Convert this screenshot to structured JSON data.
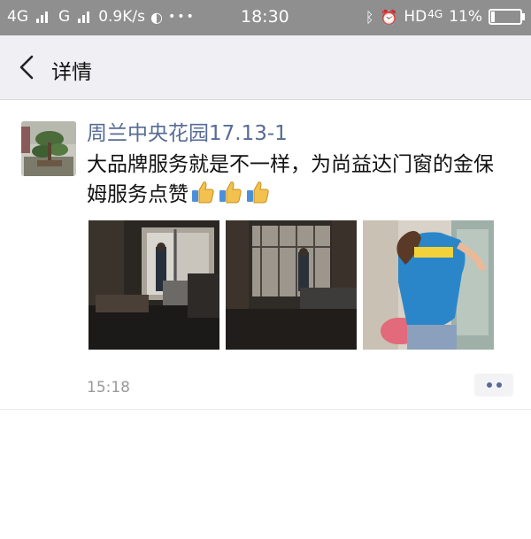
{
  "status_bar": {
    "network1": "4G",
    "network2": "G",
    "speed": "0.9K/s",
    "dots": "•••",
    "time": "18:30",
    "hd_label": "HD",
    "net3": "4G",
    "battery_text": "11%",
    "battery_fraction": 0.11
  },
  "header": {
    "title": "详情"
  },
  "post": {
    "author": "周兰中央花园17.13-1",
    "text": "大品牌服务就是不一样，为尚益达门窗的金保姆服务点赞",
    "time": "15:18",
    "thumbs_icon": "thumbs-up-icon"
  },
  "colors": {
    "name_link": "#576b95",
    "status_bar_bg": "#8f8f8f",
    "header_bg": "#efeff4"
  }
}
